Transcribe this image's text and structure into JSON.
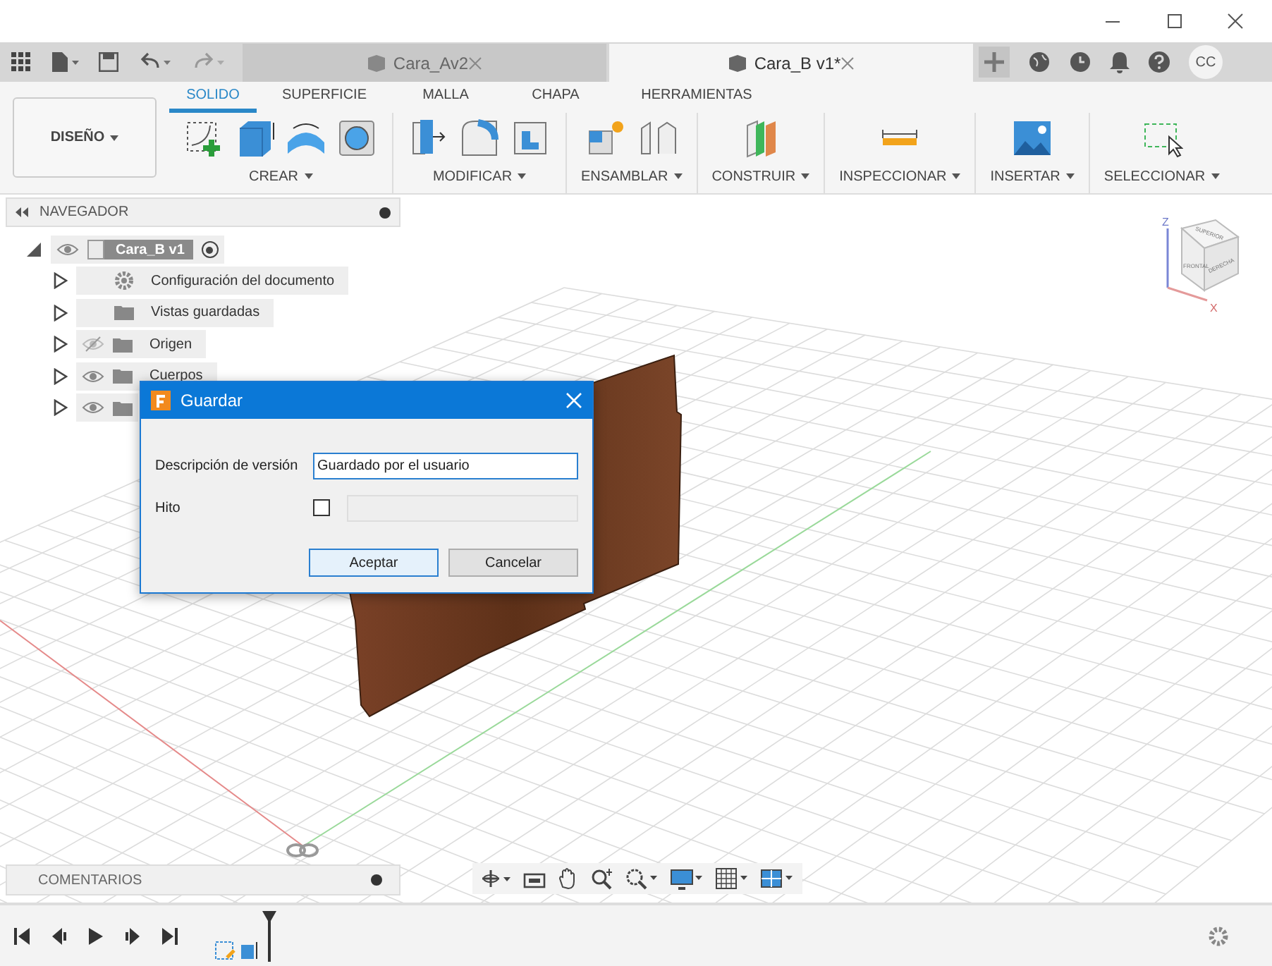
{
  "doc_tabs": [
    {
      "label": "Cara_Av2",
      "selected": false
    },
    {
      "label": "Cara_B v1*",
      "selected": true
    }
  ],
  "user_badge": "CC",
  "workspace": {
    "label": "DISEÑO"
  },
  "ribbon_tabs": [
    {
      "label": "SOLIDO",
      "selected": true
    },
    {
      "label": "SUPERFICIE",
      "selected": false
    },
    {
      "label": "MALLA",
      "selected": false
    },
    {
      "label": "CHAPA",
      "selected": false
    },
    {
      "label": "HERRAMIENTAS",
      "selected": false
    }
  ],
  "ribbon_groups": [
    {
      "label": "CREAR"
    },
    {
      "label": "MODIFICAR"
    },
    {
      "label": "ENSAMBLAR"
    },
    {
      "label": "CONSTRUIR"
    },
    {
      "label": "INSPECCIONAR"
    },
    {
      "label": "INSERTAR"
    },
    {
      "label": "SELECCIONAR"
    }
  ],
  "navigator": {
    "title": "NAVEGADOR",
    "root": {
      "label": "Cara_B v1",
      "expanded": true,
      "children": [
        {
          "label": "Configuración del documento",
          "kind": "settings"
        },
        {
          "label": "Vistas guardadas",
          "kind": "folder"
        },
        {
          "label": "Origen",
          "kind": "toggle_folder",
          "visible": false
        },
        {
          "label": "Cuerpos",
          "kind": "toggle_folder",
          "visible": true
        },
        {
          "kind": "toggle_folder",
          "visible": true
        }
      ]
    }
  },
  "dialog": {
    "title": "Guardar",
    "fields": [
      {
        "label": "Descripción de versión",
        "kind": "text",
        "value": "Guardado por el usuario"
      },
      {
        "label": "Hito",
        "kind": "checkbox_text",
        "checked": false
      }
    ],
    "buttons": [
      {
        "label": "Aceptar",
        "default": true
      },
      {
        "label": "Cancelar",
        "default": false
      }
    ]
  },
  "viewcube": {
    "faces": [
      "SUPERIOR",
      "FRONTAL",
      "DERECHA"
    ],
    "axes": [
      "Z",
      "X"
    ]
  },
  "comments": {
    "title": "COMENTARIOS"
  }
}
